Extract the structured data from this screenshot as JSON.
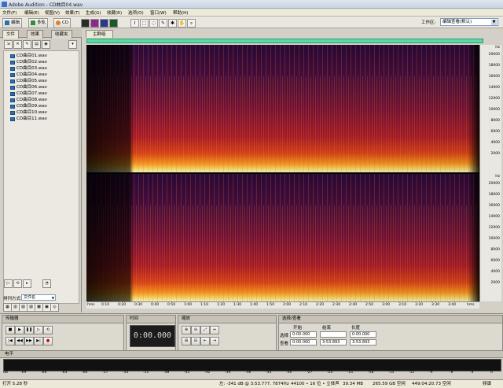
{
  "window": {
    "title": "Adobe Audition - CD曲目04.wav"
  },
  "menu": [
    "文件(F)",
    "编辑(E)",
    "视图(V)",
    "效果(T)",
    "生成(G)",
    "收藏(R)",
    "选项(O)",
    "窗口(W)",
    "帮助(H)"
  ],
  "toolbar": {
    "edit_label": "编辑",
    "multitrack_label": "多轨",
    "cd_label": "CD",
    "workspace_label": "工作区:",
    "workspace_value": "编辑查看(默认)"
  },
  "left_panel": {
    "tabs": [
      "文件",
      "效果",
      "收藏夹"
    ],
    "files": [
      "CD曲目01.wav",
      "CD曲目02.wav",
      "CD曲目03.wav",
      "CD曲目04.wav",
      "CD曲目05.wav",
      "CD曲目06.wav",
      "CD曲目07.wav",
      "CD曲目08.wav",
      "CD曲目09.wav",
      "CD曲目10.wav",
      "CD曲目11.wav"
    ],
    "sort_label": "排列方式:",
    "sort_value": "文件名"
  },
  "main_panel": {
    "tab": "主群组",
    "hz_unit": "Hz",
    "freq_labels": [
      "20000",
      "18000",
      "16000",
      "14000",
      "12000",
      "10000",
      "8000",
      "6000",
      "4000",
      "2000"
    ],
    "time_labels": [
      "hms",
      "0:10",
      "0:20",
      "0:30",
      "0:40",
      "0:50",
      "1:00",
      "1:10",
      "1:20",
      "1:30",
      "1:40",
      "1:50",
      "2:00",
      "2:10",
      "2:20",
      "2:30",
      "2:40",
      "2:50",
      "3:00",
      "3:10",
      "3:20",
      "3:30",
      "3:40",
      "hms"
    ]
  },
  "transport": {
    "title": "传输器"
  },
  "time_panel": {
    "title": "时间",
    "display": "0:00.000"
  },
  "zoom_panel": {
    "title": "缩放"
  },
  "selection_panel": {
    "title": "选择/查看",
    "col_start": "开始",
    "col_end": "结束",
    "col_length": "长度",
    "row_selection": "选择",
    "row_view": "查看",
    "sel_start": "0:00.000",
    "sel_end": "",
    "sel_length": "0:00.000",
    "view_start": "0:00.000",
    "view_end": "3:53.893",
    "view_length": "3:53.893"
  },
  "levels": {
    "title": "电平",
    "db_labels": [
      "dB",
      "-69",
      "-66",
      "-63",
      "-60",
      "-57",
      "-54",
      "-51",
      "-48",
      "-45",
      "-42",
      "-39",
      "-36",
      "-33",
      "-30",
      "-27",
      "-24",
      "-21",
      "-18",
      "-15",
      "-12",
      "-9",
      "-6",
      "-3",
      "0"
    ]
  },
  "status": {
    "open": "打开 5.28 秒",
    "cursor": "左: -341 dB @ 3:53.777, 7874Hz",
    "format": "44100 • 16 位 • 立体声",
    "size": "39.34 MB",
    "free": "265.59 GB 空闲",
    "free_time": "449:04:20.73 空闲",
    "view": "频谱"
  },
  "colors": {
    "overview": "#58d9a6",
    "spectrum_low": "#000000",
    "spectrum_mid": "#c0103a",
    "spectrum_high": "#ffee80"
  }
}
